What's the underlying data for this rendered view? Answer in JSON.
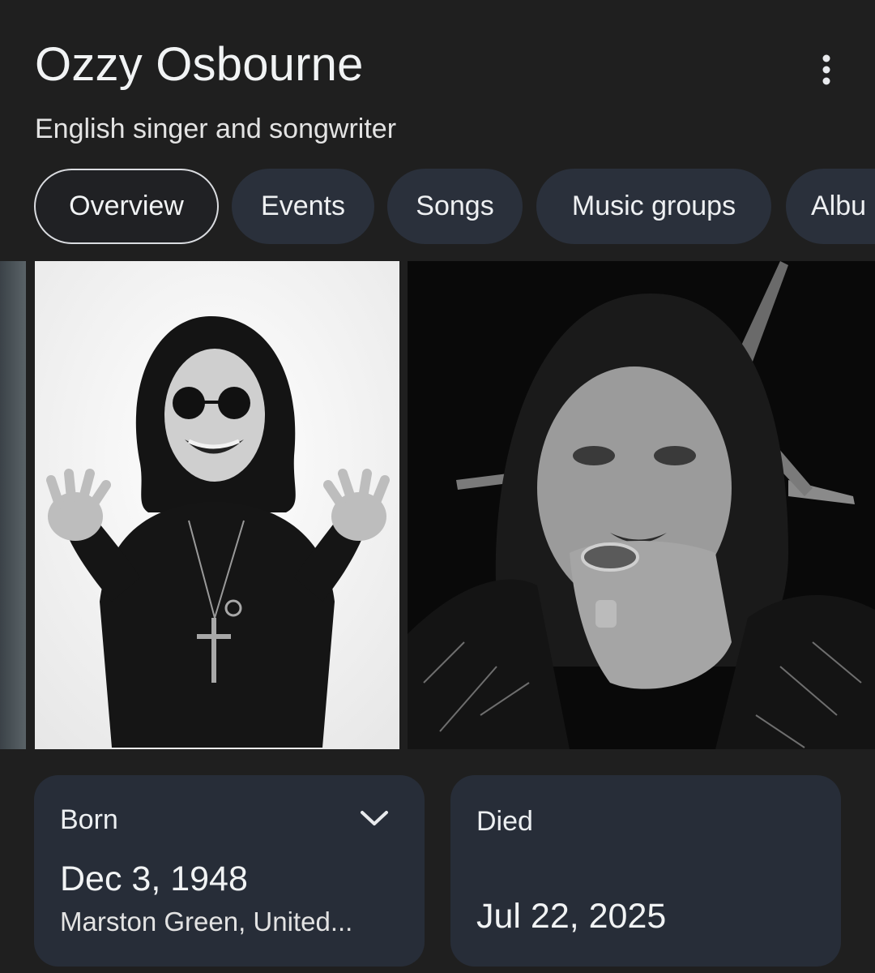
{
  "header": {
    "title": "Ozzy Osbourne",
    "subtitle": "English singer and songwriter",
    "menu_icon": "more-vert-icon"
  },
  "tabs": [
    {
      "label": "Overview",
      "active": true
    },
    {
      "label": "Events",
      "active": false
    },
    {
      "label": "Songs",
      "active": false
    },
    {
      "label": "Music groups",
      "active": false
    },
    {
      "label": "Albu",
      "active": false
    }
  ],
  "gallery": {
    "images": [
      {
        "name": "previous-image-partial"
      },
      {
        "name": "ozzy-photo-white-background"
      },
      {
        "name": "ozzy-photo-dark-background"
      }
    ]
  },
  "facts": {
    "born": {
      "label": "Born",
      "date": "Dec 3, 1948",
      "place": "Marston Green, United...",
      "expand_icon": "chevron-down-icon"
    },
    "died": {
      "label": "Died",
      "date": "Jul 22, 2025"
    }
  },
  "colors": {
    "background": "#1f1f1f",
    "chip": "#2a303b",
    "card": "#272d38",
    "text": "#e8eaed"
  }
}
